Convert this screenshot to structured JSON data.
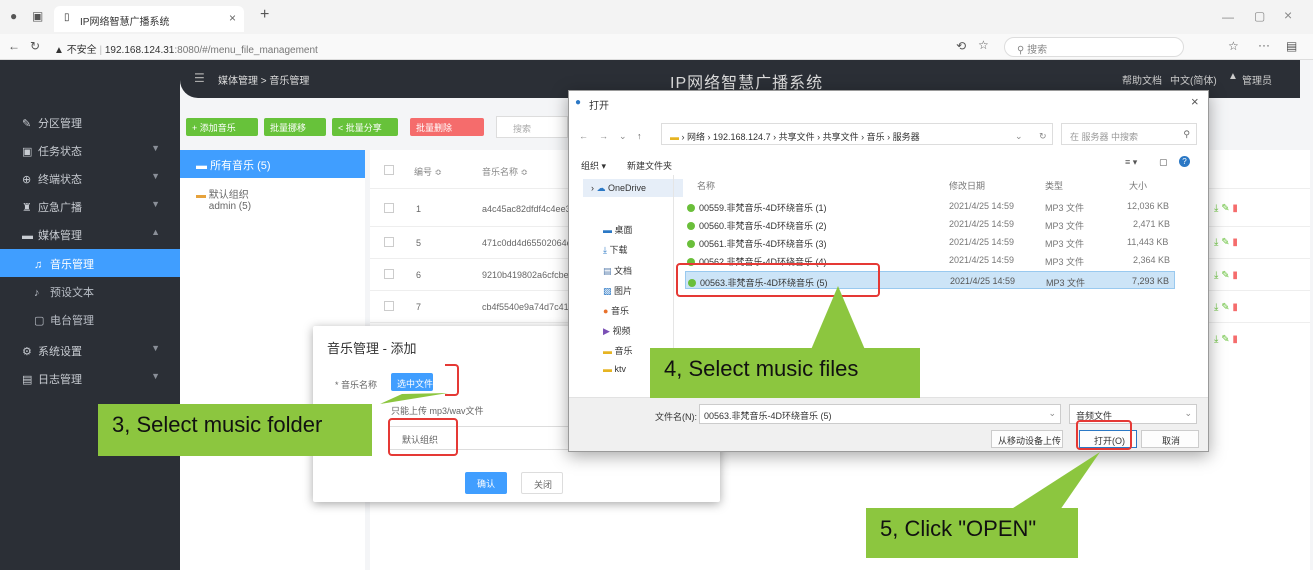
{
  "browser": {
    "tab_title": "IP网络智慧广播系统",
    "tab_close": "×",
    "new_tab": "+",
    "warning": "不安全",
    "url_host": "192.168.124.31",
    "url_path": ":8080/#/menu_file_management",
    "search_placeholder": "搜索",
    "win_min": "—",
    "win_max": "▢",
    "win_close": "×"
  },
  "app": {
    "title": "IP网络智慧广播系统",
    "breadcrumb": "媒体管理 > 音乐管理",
    "help": "帮助文档",
    "lang": "中文(简体)",
    "user": "管理员"
  },
  "sidebar": {
    "items": [
      {
        "label": "分区管理"
      },
      {
        "label": "任务状态"
      },
      {
        "label": "终端状态"
      },
      {
        "label": "应急广播"
      },
      {
        "label": "媒体管理"
      },
      {
        "label": "音乐管理"
      },
      {
        "label": "预设文本"
      },
      {
        "label": "电台管理"
      },
      {
        "label": "系统设置"
      },
      {
        "label": "日志管理"
      }
    ]
  },
  "toolbar": {
    "add_music": "+ 添加音乐",
    "batch_move": "批量挪移",
    "batch_share": "< 批量分享",
    "batch_delete": "批量删除",
    "search": "搜索"
  },
  "folders": {
    "all": "所有音乐 (5)",
    "default_group": "默认组织",
    "default_owner": "admin (5)"
  },
  "table": {
    "headers": {
      "no": "编号 ≎",
      "name": "音乐名称 ≎"
    },
    "rows": [
      {
        "no": "1",
        "name": "a4c45ac82dfdf4c4ee3"
      },
      {
        "no": "5",
        "name": "471c0dd4d65502064e"
      },
      {
        "no": "6",
        "name": "9210b419802a6cfcbe"
      },
      {
        "no": "7",
        "name": "cb4f5540e9a74d7c41"
      }
    ]
  },
  "modal": {
    "title": "音乐管理 - 添加",
    "label_music": "* 音乐名称",
    "choose_file": "选中文件",
    "hint": "只能上传 mp3/wav文件",
    "group_value": "默认组织",
    "confirm": "确认",
    "close": "关闭"
  },
  "dialog": {
    "title": "打开",
    "path": [
      "网络",
      "192.168.124.7",
      "共享文件",
      "共享文件",
      "音乐",
      "服务器"
    ],
    "search_placeholder": "在 服务器 中搜索",
    "organize": "组织 ▾",
    "new_folder": "新建文件夹",
    "nav": [
      "OneDrive",
      "桌面",
      "下载",
      "文档",
      "图片",
      "音乐",
      "视频",
      "音乐",
      "ktv"
    ],
    "col_name": "名称",
    "col_date": "修改日期",
    "col_type": "类型",
    "col_size": "大小",
    "files": [
      {
        "name": "00559.非梵音乐-4D环绕音乐 (1)",
        "date": "2021/4/25 14:59",
        "type": "MP3 文件",
        "size": "12,036 KB"
      },
      {
        "name": "00560.非梵音乐-4D环绕音乐 (2)",
        "date": "2021/4/25 14:59",
        "type": "MP3 文件",
        "size": "2,471 KB"
      },
      {
        "name": "00561.非梵音乐-4D环绕音乐 (3)",
        "date": "2021/4/25 14:59",
        "type": "MP3 文件",
        "size": "11,443 KB"
      },
      {
        "name": "00562.非梵音乐-4D环绕音乐 (4)",
        "date": "2021/4/25 14:59",
        "type": "MP3 文件",
        "size": "2,364 KB"
      },
      {
        "name": "00563.非梵音乐-4D环绕音乐 (5)",
        "date": "2021/4/25 14:59",
        "type": "MP3 文件",
        "size": "7,293 KB"
      }
    ],
    "filename_label": "文件名(N):",
    "filename_value": "00563.非梵音乐-4D环绕音乐 (5)",
    "filetype": "音频文件",
    "upload_mobile": "从移动设备上传",
    "open": "打开(O)",
    "cancel": "取消"
  },
  "annotations": {
    "step3": "3, Select music folder",
    "step4": "4, Select music files",
    "step5": "5, Click \"OPEN\""
  },
  "colors": {
    "accent": "#409eff",
    "sidebar": "#2b2f36",
    "callout": "#8cc63f",
    "highlight": "#e53935"
  }
}
